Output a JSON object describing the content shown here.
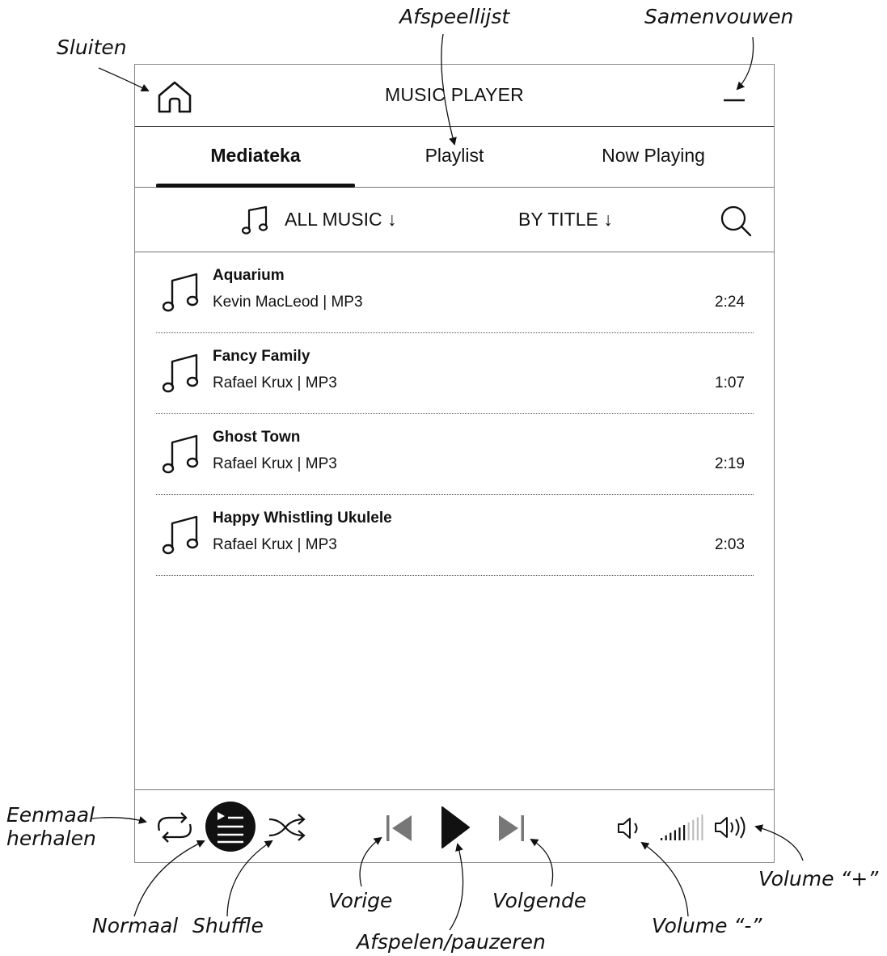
{
  "header": {
    "title": "MUSIC PLAYER",
    "home_icon": "home-icon",
    "collapse_icon": "minimize-icon"
  },
  "tabs": [
    {
      "label": "Mediateka",
      "active": true
    },
    {
      "label": "Playlist",
      "active": false
    },
    {
      "label": "Now Playing",
      "active": false
    }
  ],
  "filters": {
    "source_label": "ALL MUSIC ↓",
    "sort_label": "BY TITLE ↓",
    "source_icon": "music-note-icon",
    "search_icon": "search-icon"
  },
  "tracks": [
    {
      "title": "Aquarium",
      "subtitle": "Kevin MacLeod | MP3",
      "duration": "2:24"
    },
    {
      "title": "Fancy Family",
      "subtitle": "Rafael Krux | MP3",
      "duration": "1:07"
    },
    {
      "title": "Ghost Town",
      "subtitle": "Rafael Krux | MP3",
      "duration": "2:19"
    },
    {
      "title": "Happy Whistling Ukulele",
      "subtitle": "Rafael Krux | MP3",
      "duration": "2:03"
    }
  ],
  "controls": {
    "repeat_icon": "repeat-icon",
    "normal_icon": "normal-order-icon",
    "normal_active": true,
    "shuffle_icon": "shuffle-icon",
    "previous_icon": "previous-icon",
    "play_icon": "play-icon",
    "next_icon": "next-icon",
    "volume_down_icon": "volume-down-icon",
    "volume_up_icon": "volume-up-icon",
    "volume_bars_total": 10,
    "volume_bars_filled": 6
  },
  "annotations": {
    "close": "Sluiten",
    "playlist": "Afspeellijst",
    "collapse": "Samenvouwen",
    "repeat_once_1": "Eenmaal",
    "repeat_once_2": "herhalen",
    "normal": "Normaal",
    "shuffle": "Shuffle",
    "previous": "Vorige",
    "play_pause": "Afspelen/pauzeren",
    "next": "Volgende",
    "volume_down": "Volume “-”",
    "volume_up": "Volume “+”"
  }
}
